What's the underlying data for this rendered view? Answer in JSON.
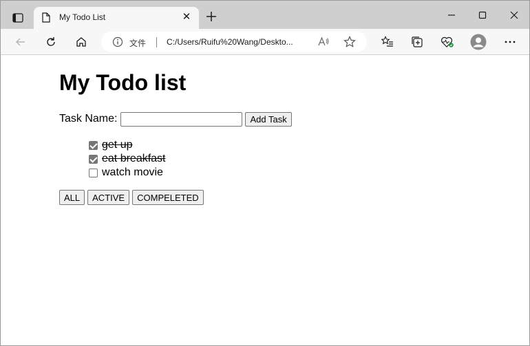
{
  "browser": {
    "tab": {
      "title": "My Todo List",
      "close_glyph": "✕"
    },
    "new_tab_icon": "plus-icon",
    "window_controls": [
      "minimize-icon",
      "maximize-icon",
      "close-icon"
    ],
    "address_bar": {
      "file_label": "文件",
      "url": "C:/Users/Ruifu%20Wang/Deskto..."
    }
  },
  "page": {
    "title": "My Todo list",
    "task_name_label": "Task Name:",
    "task_input_value": "",
    "add_task_label": "Add Task",
    "todos": [
      {
        "text": "get up",
        "done": true
      },
      {
        "text": "eat breakfast",
        "done": true
      },
      {
        "text": "watch movie",
        "done": false
      }
    ],
    "filters": {
      "all": "ALL",
      "active": "ACTIVE",
      "completed": "COMPELETED"
    }
  },
  "colors": {
    "tabstrip": "#cfcfcf",
    "toolbar": "#f7f7f7",
    "profile_avatar": "#8a8a8a"
  }
}
